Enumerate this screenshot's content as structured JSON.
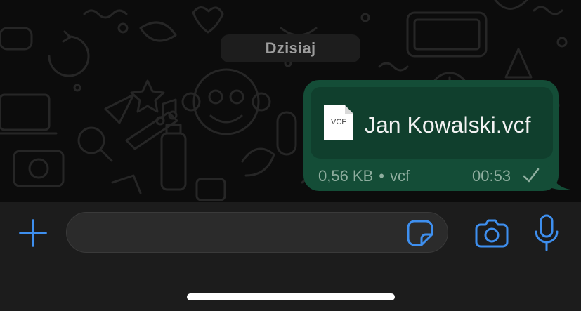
{
  "chat": {
    "date_separator": "Dzisiaj"
  },
  "message": {
    "file_icon_label": "VCF",
    "file_name": "Jan Kowalski.vcf",
    "file_size": "0,56 KB",
    "separator": "•",
    "file_type": "vcf",
    "time": "00:53",
    "status_icon": "check-icon",
    "bubble_color": "#144d37"
  },
  "input_bar": {
    "placeholder": "",
    "attach_icon": "plus-icon",
    "sticker_icon": "sticker-icon",
    "camera_icon": "camera-icon",
    "mic_icon": "mic-icon",
    "accent_color": "#3e8fef"
  }
}
